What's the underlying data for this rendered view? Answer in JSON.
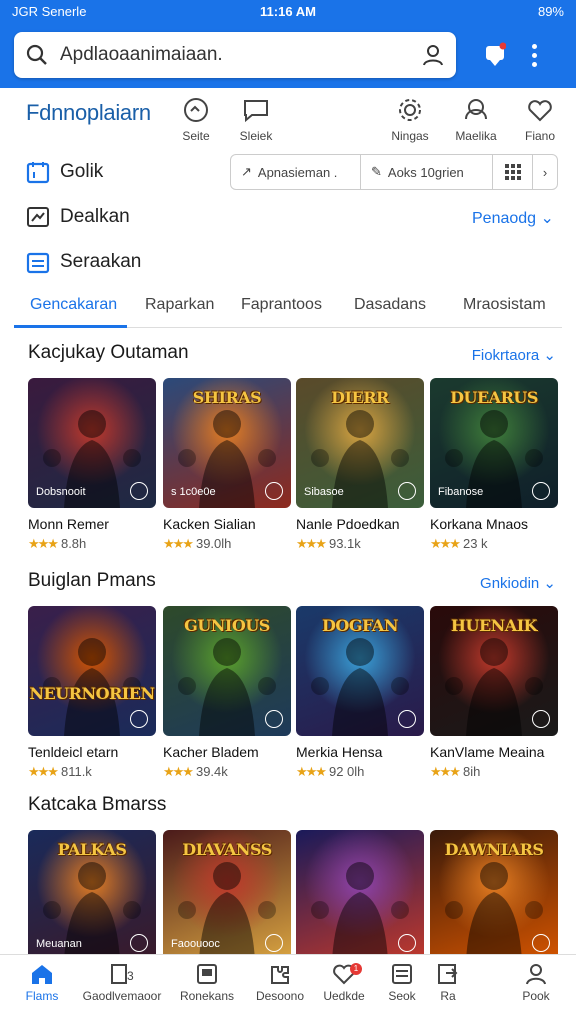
{
  "status": {
    "left": "JGR Senerle",
    "time": "11:16 AM",
    "battery": "89%"
  },
  "search": {
    "text": "Apdlaoaanimaiaan."
  },
  "brand": "Fdnnoplaiarn",
  "nav_icons": [
    {
      "label": "Seite",
      "icon": "gamepad-icon"
    },
    {
      "label": "Sleiek",
      "icon": "chat-icon"
    },
    {
      "label": "Ningas",
      "icon": "gear-icon"
    },
    {
      "label": "Maelika",
      "icon": "profile-icon"
    },
    {
      "label": "Fiano",
      "icon": "heart-icon"
    }
  ],
  "list": [
    {
      "label": "Golik",
      "icon": "calendar-icon"
    },
    {
      "label": "Dealkan",
      "icon": "graph-icon"
    },
    {
      "label": "Seraakan",
      "icon": "list-icon"
    }
  ],
  "segments": {
    "a": "Apnasieman .",
    "b": "Aoks 10grien"
  },
  "sort_label": "Penaodg",
  "tabs": [
    "Gencakaran",
    "Raparkan",
    "Faprantoos",
    "Dasadans",
    "Mraosistam"
  ],
  "sections": [
    {
      "title": "Kacjukay Outaman",
      "more": "Fiokrtaora",
      "cards": [
        {
          "name": "Monn Remer",
          "rating": "8.8h",
          "badge": "Dobsnooit",
          "colors": [
            "#3a1a3e",
            "#c0392b",
            "#1e2a44"
          ],
          "banner": ""
        },
        {
          "name": "Kacken Sialian",
          "rating": "39.0lh",
          "badge": "s 1c0e0e",
          "colors": [
            "#2b4a7a",
            "#e67e22",
            "#8e2a1e"
          ],
          "banner": "SHIRAS"
        },
        {
          "name": "Nanle Pdoedkan",
          "rating": "93.1k",
          "badge": "Sibasoe",
          "colors": [
            "#5a4a2a",
            "#d9a441",
            "#3b5e3b"
          ],
          "banner": "DIERR"
        },
        {
          "name": "Korkana Mnaos",
          "rating": "23 k",
          "badge": "Fibanose",
          "colors": [
            "#1b3a2e",
            "#3f7d3a",
            "#0f1f2a"
          ],
          "banner": "DUEARUS"
        }
      ]
    },
    {
      "title": "Buiglan Pmans",
      "more": "Gnkiodin",
      "cards": [
        {
          "name": "Tenldeicl etarn",
          "rating": "811.k",
          "badge": "",
          "colors": [
            "#3a1f4a",
            "#d35400",
            "#1a2b5a"
          ],
          "banner": "NEURNORIEN"
        },
        {
          "name": "Kacher Bladem",
          "rating": "39.4k",
          "badge": "",
          "colors": [
            "#2e4a2a",
            "#5aa02c",
            "#1e3a5a"
          ],
          "banner": "GUNIOUS"
        },
        {
          "name": "Merkia Hensa",
          "rating": "92 0lh",
          "badge": "",
          "colors": [
            "#1a3a6a",
            "#3aa0d8",
            "#2a1a4a"
          ],
          "banner": "DOGFAN"
        },
        {
          "name": "KanVlame Meaina",
          "rating": "8ih",
          "badge": "",
          "colors": [
            "#2a0a0a",
            "#c0392b",
            "#1a1a1a"
          ],
          "banner": "HUENAIK"
        }
      ]
    },
    {
      "title": "Katcaka Bmarss",
      "more": "",
      "cards": [
        {
          "name": "",
          "rating": "",
          "badge": "Meuanan",
          "colors": [
            "#1a2a5a",
            "#e67e22",
            "#3a1a2a"
          ],
          "banner": "PALKAS"
        },
        {
          "name": "",
          "rating": "",
          "badge": "Faoouooc",
          "colors": [
            "#4a1a1a",
            "#c0392b",
            "#d9a441"
          ],
          "banner": "DIAVANSS"
        },
        {
          "name": "",
          "rating": "",
          "badge": "",
          "colors": [
            "#1a1a5a",
            "#8e44ad",
            "#c0392b"
          ],
          "banner": ""
        },
        {
          "name": "",
          "rating": "",
          "badge": "",
          "colors": [
            "#3a1a0a",
            "#e67e22",
            "#d35400"
          ],
          "banner": "DAWNIARS"
        }
      ]
    }
  ],
  "bottom_nav": [
    {
      "label": "Flams",
      "icon": "home-icon"
    },
    {
      "label": "Gaodlvemaoor",
      "icon": "library-icon"
    },
    {
      "label": "Ronekans",
      "icon": "apps-icon"
    },
    {
      "label": "Desoono",
      "icon": "puzzle-icon"
    },
    {
      "label": "Uedkde",
      "icon": "heart-icon",
      "badge": "1"
    },
    {
      "label": "Seok",
      "icon": "menu-icon"
    },
    {
      "label": "Ra",
      "icon": "share-icon"
    },
    {
      "label": "Pook",
      "icon": "user-icon"
    }
  ]
}
